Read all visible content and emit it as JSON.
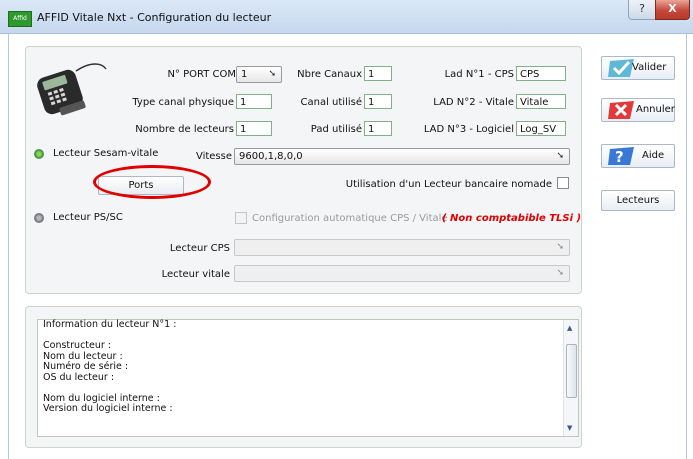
{
  "window": {
    "title": "AFFID Vitale Nxt - Configuration du lecteur",
    "app_icon_text": "Affid",
    "help_label": "?",
    "close_label": "X"
  },
  "config": {
    "port_com_label": "N° PORT COM",
    "port_com_value": "1",
    "type_canal_label": "Type canal physique",
    "type_canal_value": "1",
    "nombre_lecteurs_label": "Nombre de lecteurs",
    "nombre_lecteurs_value": "1",
    "nbre_canaux_label": "Nbre Canaux",
    "nbre_canaux_value": "1",
    "canal_utilise_label": "Canal utilisé",
    "canal_utilise_value": "1",
    "pad_utilise_label": "Pad utilisé",
    "pad_utilise_value": "1",
    "lad1_label": "Lad N°1 - CPS",
    "lad1_value": "CPS",
    "lad2_label": "LAD N°2 - Vitale",
    "lad2_value": "Vitale",
    "lad3_label": "LAD N°3 - Logiciel",
    "lad3_value": "Log_SV"
  },
  "sesam": {
    "radio_label": "Lecteur Sesam-vitale",
    "selected": true,
    "vitesse_label": "Vitesse",
    "vitesse_value": "9600,1,8,0,0",
    "ports_button": "Ports",
    "nomade_label": "Utilisation d'un Lecteur bancaire nomade"
  },
  "pssc": {
    "radio_label": "Lecteur PS/SC",
    "auto_config_label": "Configuration automatique CPS / Vitale",
    "warning": "( Non comptabible TLSi )",
    "lecteur_cps_label": "Lecteur CPS",
    "lecteur_cps_value": "",
    "lecteur_vitale_label": "Lecteur vitale",
    "lecteur_vitale_value": ""
  },
  "info": {
    "text": "Information du lecteur N°1 :\n\nConstructeur :\nNom du lecteur :\nNuméro de série :\nOS du lecteur :\n\nNom du logiciel interne :\nVersion du logiciel interne :"
  },
  "side": {
    "valider": "Valider",
    "annuler": "Annuler",
    "aide": "Aide",
    "lecteurs": "Lecteurs"
  },
  "colors": {
    "accent_green": "#3a8f2a",
    "warning_red": "#e00000"
  }
}
